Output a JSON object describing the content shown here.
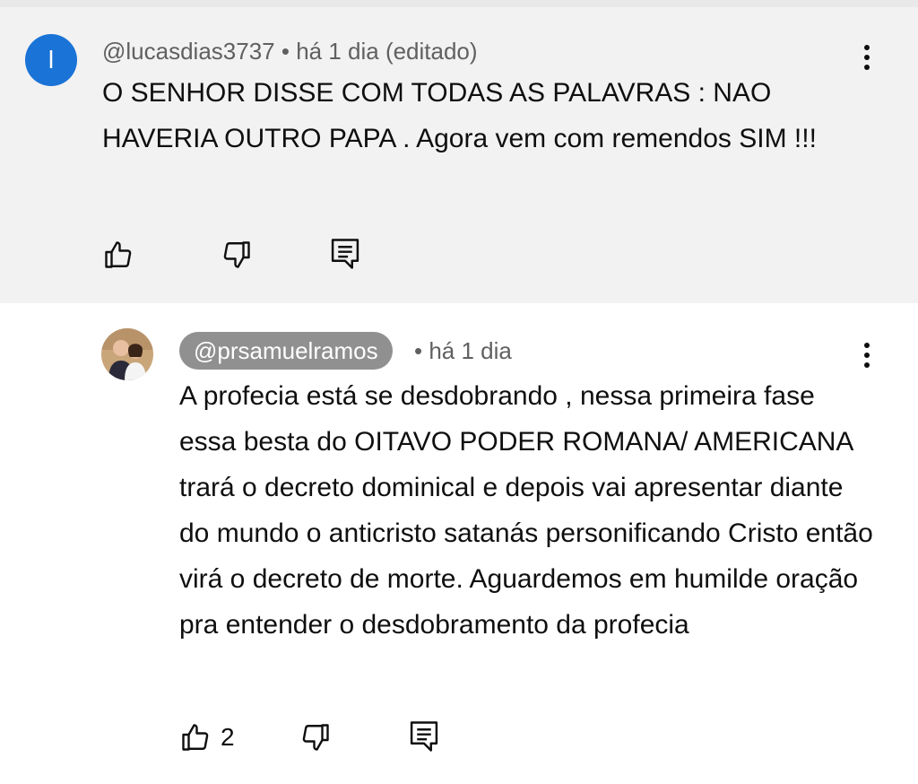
{
  "comments": [
    {
      "avatar_letter": "l",
      "author": "@lucasdias3737",
      "meta": " • há 1 dia (editado)",
      "text": "O SENHOR DISSE COM TODAS AS PALAVRAS : NAO HAVERIA OUTRO PAPA . Agora vem com remendos SIM !!!",
      "likes": ""
    },
    {
      "author": "@prsamuelramos",
      "meta": "• há 1 dia",
      "text": "A profecia está se desdobrando , nessa primeira fase essa besta do OITAVO PODER ROMANA/ AMERICANA trará o decreto dominical e depois vai apresentar diante do mundo o anticristo satanás personificando Cristo então virá o decreto de morte. Aguardemos em humilde oração pra entender o desdobramento da profecia",
      "likes": "2"
    }
  ],
  "icons": {
    "like": "thumbs-up-icon",
    "dislike": "thumbs-down-icon",
    "reply": "reply-comment-icon",
    "menu": "more-vertical-icon"
  },
  "colors": {
    "avatar_blue": "#1a73d6",
    "highlight_bg": "#f2f2f2",
    "handle_pill": "#909090",
    "meta_text": "#606060"
  }
}
